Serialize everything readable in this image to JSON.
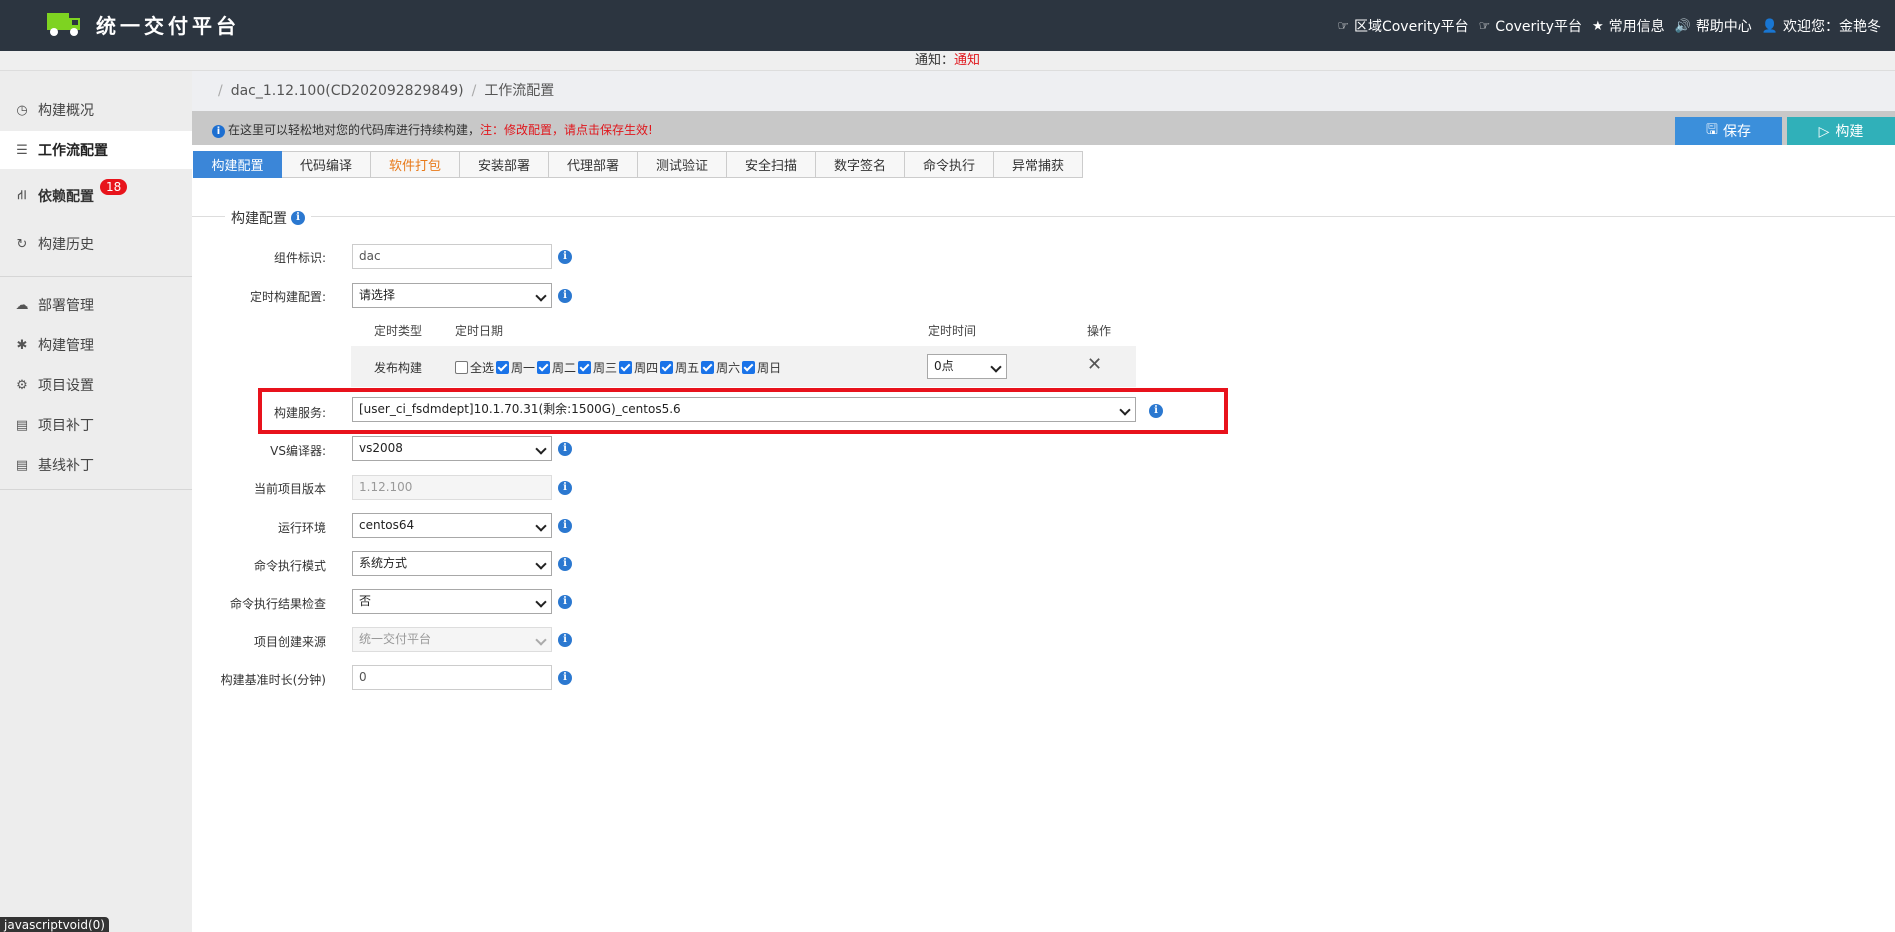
{
  "header": {
    "title": "统一交付平台",
    "nav": [
      {
        "icon": "hand-point-icon",
        "label": "区域Coverity平台"
      },
      {
        "icon": "hand-point-icon",
        "label": "Coverity平台"
      },
      {
        "icon": "star-icon",
        "label": "常用信息"
      },
      {
        "icon": "speaker-icon",
        "label": "帮助中心"
      },
      {
        "icon": "user-icon",
        "label": "欢迎您：金艳冬"
      }
    ]
  },
  "notice": {
    "label": "通知：",
    "link": "通知"
  },
  "sidebar": {
    "items": [
      {
        "icon": "clock-icon",
        "label": "构建概况"
      },
      {
        "icon": "list-icon",
        "label": "工作流配置"
      },
      {
        "icon": "road-icon",
        "label": "依赖配置",
        "badge": "18"
      },
      {
        "icon": "refresh-icon",
        "label": "构建历史"
      },
      {
        "icon": "cloud-icon",
        "label": "部署管理"
      },
      {
        "icon": "asterisk-icon",
        "label": "构建管理"
      },
      {
        "icon": "gear-icon",
        "label": "项目设置"
      },
      {
        "icon": "card-icon",
        "label": "项目补丁"
      },
      {
        "icon": "card-icon",
        "label": "基线补丁"
      }
    ]
  },
  "status_tooltip": "javascriptvoid(0)",
  "breadcrumb": {
    "project": "dac_1.12.100(CD202092829849)",
    "page": "工作流配置"
  },
  "infobar": {
    "text": "在这里可以轻松地对您的代码库进行持续构建，",
    "warning": "注：修改配置，请点击保存生效!"
  },
  "actions": {
    "save": "保存",
    "build": "构建"
  },
  "tabs": [
    "构建配置",
    "代码编译",
    "软件打包",
    "安装部署",
    "代理部署",
    "测试验证",
    "安全扫描",
    "数字签名",
    "命令执行",
    "异常捕获"
  ],
  "section_title": "构建配置",
  "form": {
    "component_id": {
      "label": "组件标识:",
      "value": "dac"
    },
    "schedule_config": {
      "label": "定时构建配置:",
      "value": "请选择"
    },
    "build_service": {
      "label": "构建服务:",
      "value": "[user_ci_fsdmdept]10.1.70.31(剩余:1500G)_centos5.6"
    },
    "vs_compiler": {
      "label": "VS编译器:",
      "value": "vs2008"
    },
    "project_version": {
      "label": "当前项目版本",
      "value": "1.12.100"
    },
    "runtime_env": {
      "label": "运行环境",
      "value": "centos64"
    },
    "cmd_mode": {
      "label": "命令执行模式",
      "value": "系统方式"
    },
    "cmd_check": {
      "label": "命令执行结果检查",
      "value": "否"
    },
    "project_source": {
      "label": "项目创建来源",
      "value": "统一交付平台"
    },
    "baseline_duration": {
      "label": "构建基准时长(分钟)",
      "value": "0"
    }
  },
  "schedule": {
    "headers": {
      "type": "定时类型",
      "date": "定时日期",
      "time": "定时时间",
      "op": "操作"
    },
    "row": {
      "type": "发布构建",
      "select_all": {
        "label": "全选",
        "checked": false
      },
      "days": [
        {
          "label": "周一",
          "checked": true
        },
        {
          "label": "周二",
          "checked": true
        },
        {
          "label": "周三",
          "checked": true
        },
        {
          "label": "周四",
          "checked": true
        },
        {
          "label": "周五",
          "checked": true
        },
        {
          "label": "周六",
          "checked": true
        },
        {
          "label": "周日",
          "checked": true
        }
      ],
      "time": "0点"
    }
  },
  "colors": {
    "accent": "#3b86d8",
    "highlight": "#e8121c",
    "topbar": "#2c3540",
    "build_button": "#30b0b9"
  }
}
